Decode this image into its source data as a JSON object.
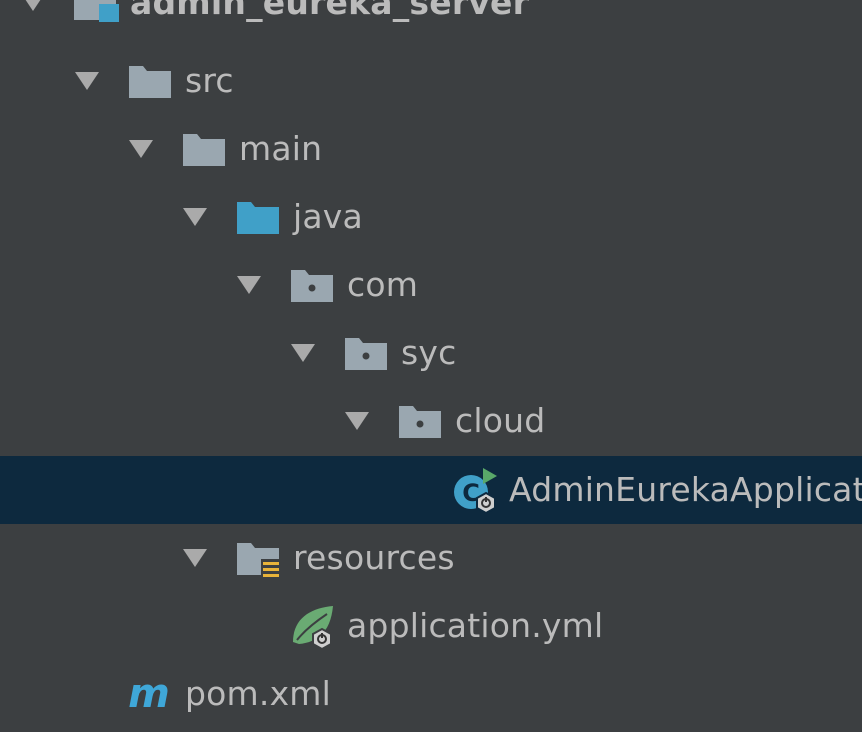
{
  "project_tree": {
    "items": [
      {
        "label": "admin_eureka_server",
        "icon": "module-folder-icon",
        "expanded": true
      },
      {
        "label": "src",
        "icon": "folder-icon",
        "expanded": true
      },
      {
        "label": "main",
        "icon": "folder-icon",
        "expanded": true
      },
      {
        "label": "java",
        "icon": "source-root-folder-icon",
        "expanded": true
      },
      {
        "label": "com",
        "icon": "package-folder-icon",
        "expanded": true
      },
      {
        "label": "syc",
        "icon": "package-folder-icon",
        "expanded": true
      },
      {
        "label": "cloud",
        "icon": "package-folder-icon",
        "expanded": true
      },
      {
        "label": "AdminEurekaApplicat",
        "icon": "spring-boot-application-class-icon",
        "selected": true
      },
      {
        "label": "resources",
        "icon": "resources-folder-icon",
        "expanded": true
      },
      {
        "label": "application.yml",
        "icon": "spring-config-file-icon"
      },
      {
        "label": "pom.xml",
        "icon": "maven-pom-icon"
      }
    ]
  },
  "colors": {
    "background": "#3c3f41",
    "selection": "#0d293e",
    "text": "#bbbbbb",
    "folder": "#9aa7b0",
    "source_root": "#40a0c8",
    "spring_green": "#6aab73",
    "maven_blue": "#3fa7d8",
    "resources_marker": "#e8b33a"
  }
}
